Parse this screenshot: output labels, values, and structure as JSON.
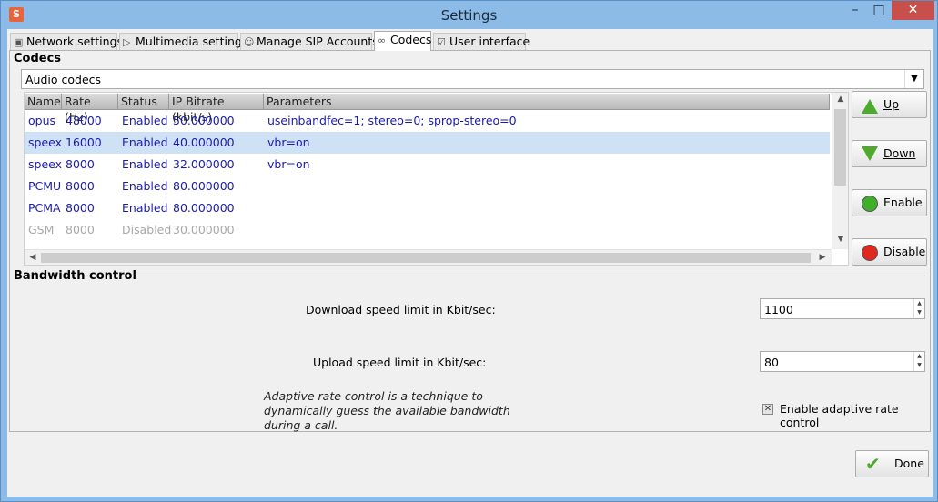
{
  "window": {
    "title": "Settings",
    "minimize_glyph": "–",
    "maximize_glyph": "□",
    "close_glyph": "✕"
  },
  "tabs": [
    {
      "label": "Network settings",
      "icon": "network-icon",
      "active": false
    },
    {
      "label": "Multimedia settings",
      "icon": "play-icon",
      "active": false
    },
    {
      "label": "Manage SIP Accounts",
      "icon": "accounts-icon",
      "active": false
    },
    {
      "label": "Codecs",
      "icon": "link-icon",
      "active": true
    },
    {
      "label": "User interface",
      "icon": "interface-icon",
      "active": false
    }
  ],
  "codecs": {
    "group_label": "Codecs",
    "codec_type_select": "Audio codecs",
    "columns": [
      "Name",
      "Rate (Hz)",
      "Status",
      "IP Bitrate (kbit/s)",
      "Parameters"
    ],
    "rows": [
      {
        "name": "opus",
        "rate": "48000",
        "status": "Enabled",
        "bitrate": "50.000000",
        "params": "useinbandfec=1; stereo=0; sprop-stereo=0",
        "selected": false,
        "disabled": false
      },
      {
        "name": "speex",
        "rate": "16000",
        "status": "Enabled",
        "bitrate": "40.000000",
        "params": "vbr=on",
        "selected": true,
        "disabled": false
      },
      {
        "name": "speex",
        "rate": "8000",
        "status": "Enabled",
        "bitrate": "32.000000",
        "params": "vbr=on",
        "selected": false,
        "disabled": false
      },
      {
        "name": "PCMU",
        "rate": "8000",
        "status": "Enabled",
        "bitrate": "80.000000",
        "params": "",
        "selected": false,
        "disabled": false
      },
      {
        "name": "PCMA",
        "rate": "8000",
        "status": "Enabled",
        "bitrate": "80.000000",
        "params": "",
        "selected": false,
        "disabled": false
      },
      {
        "name": "GSM",
        "rate": "8000",
        "status": "Disabled",
        "bitrate": "30.000000",
        "params": "",
        "selected": false,
        "disabled": true
      }
    ],
    "buttons": {
      "up": "Up",
      "down": "Down",
      "enable": "Enable",
      "disable": "Disable"
    }
  },
  "bandwidth": {
    "group_label": "Bandwidth control",
    "download_label": "Download speed limit in Kbit/sec:",
    "download_value": "1100",
    "upload_label": "Upload speed limit in Kbit/sec:",
    "upload_value": "80",
    "note": "Adaptive rate control is a technique to dynamically guess the available bandwidth during a call.",
    "adaptive_label": "Enable adaptive rate control",
    "adaptive_checked": true
  },
  "footer": {
    "done_label": "Done"
  },
  "colors": {
    "link_text": "#1a1ab0",
    "selected_row": "#cfe2f5",
    "close_button": "#c7514a",
    "titlebar": "#8bbbe6",
    "enable_icon": "#3fae2a",
    "disable_icon": "#e0281c",
    "arrow_icon": "#4caa2c"
  }
}
